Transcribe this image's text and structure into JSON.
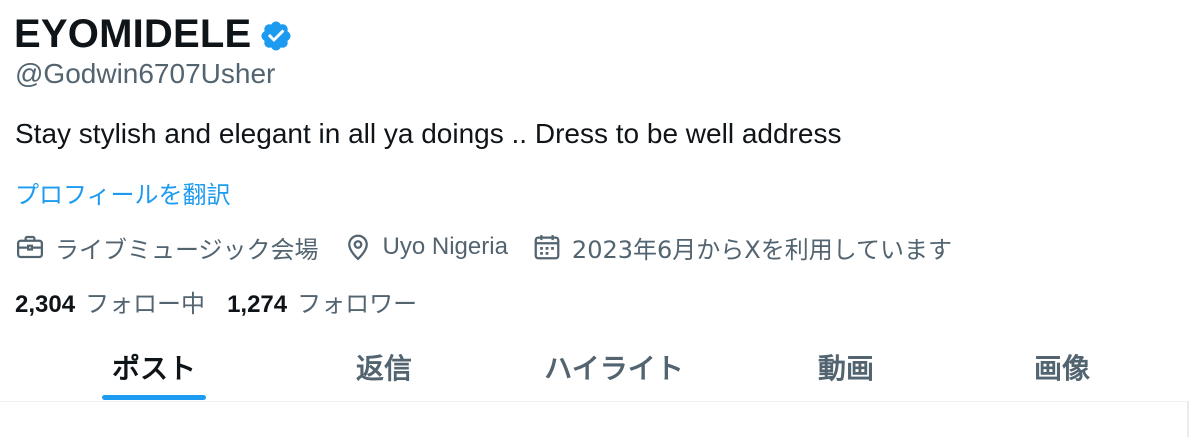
{
  "profile": {
    "display_name": "EYOMIDELE",
    "verified_icon": "verified-badge-icon",
    "handle": "@Godwin6707Usher",
    "bio": "Stay stylish and elegant in all ya doings .. Dress to be well address",
    "translate_label": "プロフィールを翻訳"
  },
  "meta": {
    "category": {
      "icon": "briefcase-icon",
      "label": "ライブミュージック会場"
    },
    "location": {
      "icon": "location-pin-icon",
      "label": "Uyo Nigeria"
    },
    "joined": {
      "icon": "calendar-icon",
      "label": "2023年6月からXを利用しています"
    }
  },
  "follow": {
    "following_count": "2,304",
    "following_label": "フォロー中",
    "followers_count": "1,274",
    "followers_label": "フォロワー"
  },
  "tabs": [
    {
      "label": "ポスト",
      "active": true
    },
    {
      "label": "返信",
      "active": false
    },
    {
      "label": "ハイライト",
      "active": false
    },
    {
      "label": "動画",
      "active": false
    },
    {
      "label": "画像",
      "active": false
    }
  ],
  "colors": {
    "accent": "#1d9bf0",
    "text_primary": "#0f1419",
    "text_secondary": "#536471"
  }
}
